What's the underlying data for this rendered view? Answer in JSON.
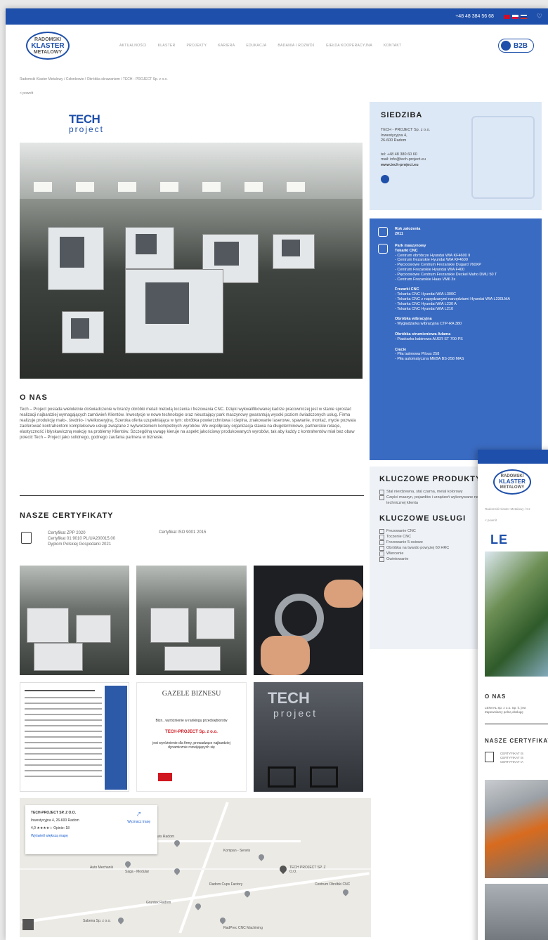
{
  "topbar": {
    "phone": "+48 48 384 56 68",
    "flags": [
      {
        "name": "uk-flag",
        "color": "#c8102e"
      },
      {
        "name": "pl-flag",
        "color": "#dc143c"
      },
      {
        "name": "ru-flag",
        "color": "#0039a6"
      }
    ]
  },
  "logo": {
    "line1": "RADOMSKI",
    "line2": "KLASTER",
    "line3": "METALOWY"
  },
  "nav": [
    "AKTUALNOŚCI",
    "KLASTER",
    "PROJEKTY",
    "KARIERA",
    "EDUKACJA",
    "BADANIA I ROZWÓJ",
    "GIEŁDA KOOPERACYJNA",
    "KONTAKT"
  ],
  "b2b": "B2B",
  "breadcrumb": "Radomski Klaster Metalowy / Członkowie / Obróbka skrawaniem / TECH - PROJECT Sp. z o.o.",
  "back": "< powrót",
  "company_logo": {
    "line1": "TECH",
    "line2": "project"
  },
  "onas": {
    "title": "O NAS",
    "text": "Tech – Project posiada wieloletnie doświadczenie w branży obróbki metali metodą toczenia i frezowania CNC. Dzięki wykwalifikowanej kadrze pracowniczej jest w stanie sprostać realizacji najbardziej wymagających zamówień Klientów. Inwestycje w nowe technologie oraz nieustający park maszynowy gwarantują wysoki poziom świadczonych usług. Firma realizuje produkcję mało-, średnio- i wielkoseryjną. Szeroka oferta uzupełniająca w tym: obróbka powierzchniowa i cieplna, znakowanie laserowe, spawanie, montaż, mycie pozwala zaoferować kontrahentom kompleksowe usługi związane z wytworzeniem kompletnych wyrobów. We współpracy organizacja stawia na długoterminowe, partnerskie relacje, elastyczność i błyskawiczną reakcję na problemy Klientów. Szczególną uwagę kieruje na aspekt jakościowy produkowanych wyrobów, tak aby każdy z kontrahentów miał bez obaw polecić Tech – Project jako solidnego, godnego zaufania partnera w biznesie."
  },
  "certs": {
    "title": "NASZE CERTYFIKATY",
    "col1": [
      "Certyfikat ZPP 2020",
      "Certyfikat 01 9010 PL/UA200015.00",
      "Dyplom Polskiej Gospodarki 2021"
    ],
    "col2": [
      "Certyfikat ISO 9001 2015"
    ]
  },
  "gallery": {
    "gazele_title": "GAZELE BIZNESU",
    "gazele_line1": "Bizn., wyróżnienie w rankingu przedsiębiorstw",
    "gazele_company": "TECH-PROJECT Sp. z o.o.",
    "gazele_line2": "jest wyróżnienie dla firmy, prowadzące najbardziej dynamicznie rozwijających się",
    "wall_line1": "TECH",
    "wall_line2": "project"
  },
  "map": {
    "card_title": "TECH-PROJECT SP. Z O.O.",
    "card_addr": "Inwestycyjna 4, 26-600 Radom",
    "card_rating": "4,0 ★★★★☆ Opinie: 18",
    "card_link": "Wyświetl większą mapę",
    "directions": "Wyznacz trasę",
    "labels": [
      "TECH PROJECT SP. Z O.O.",
      "RadPrec CNC Machining",
      "Radom Cups Factory",
      "Kompan - Serwis",
      "Saga - Modular",
      "Gruntex Radom",
      "MAN Serwis Radom",
      "Auto Mechanik",
      "Centrum Obróbki CNC",
      "Sabena Sp. z o.o."
    ]
  },
  "siedziba": {
    "title": "SIEDZIBA",
    "address": [
      "TECH - PROJECT Sp. z o.o.",
      "Inwestycyjna 4,",
      "26-600 Radom"
    ],
    "contact": [
      "tel: +48 48 380 60 60",
      "mail: info@tech-project.eu",
      "www.tech-project.eu"
    ]
  },
  "info": {
    "rok_label": "Rok założenia",
    "rok_value": "2011",
    "park_label": "Park maszynowy",
    "groups": [
      {
        "title": "Tokarki CNC",
        "items": [
          "- Centrum obróbcze Hyundai WIA KF4600 II",
          "- Centrum frezarskie Hyundai WIA KF4600",
          "- Pięcioosiowe Centrum Frezarskie Dugard 760XP",
          "- Centrum Frezarskie Hyundai WIA F400",
          "- Pięcioosiowe Centrum Frezarskie Deckel Maho DMU 50 T",
          "- Centrum Frezarskie Haas VM6 3x"
        ]
      },
      {
        "title": "Frezarki CNC",
        "items": [
          "- Tokarka CNC Hyundai WIA L300C",
          "- Tokarka CNC z napędzanymi narzędziami Hyundai WIA L230LMA",
          "- Tokarka CNC Hyundai WIA L230 A",
          "- Tokarka CNC Hyundai WIA L210"
        ]
      },
      {
        "title": "Obróbka wibracyjna",
        "items": [
          "- Wygładzarka wibracyjna CTP-RA 380"
        ]
      },
      {
        "title": "Obróbka strumieniowa Adama",
        "items": [
          "- Piaskarka kabinowa AUER ST 700 PS"
        ]
      },
      {
        "title": "Cięcie",
        "items": [
          "- Piła taśmowa Pilous 258",
          "- Piła automatyczna MEBA BS-258 MAS"
        ]
      }
    ]
  },
  "kluczowe": {
    "produkty_title": "KLUCZOWE PRODUKTY",
    "produkty": [
      "Stal nierdzewna, stal czarna, metal kolorowy",
      "Części maszyn, pojazdów i urządzeń wykonywane na podstawie dokumentacji technicznej klienta"
    ],
    "uslugi_title": "KLUCZOWE USŁUGI",
    "uslugi": [
      "Frezowanie CNC",
      "Toczenie CNC",
      "Frezowanie 5-osiowe",
      "Obróbka na twardo powyżej 60 HRC",
      "Wiercenie",
      "Gwintowanie"
    ]
  },
  "overlay": {
    "logo": {
      "line1": "RADOMSKI",
      "line2": "KLASTER",
      "line3": "METALOWY"
    },
    "breadcrumb": "Radomski Klaster Metalowy / Cz",
    "back": "< powrót",
    "brand": "LE",
    "onas_title": "O NAS",
    "onas_text": [
      "LENAAL Sp. z o.o. Sp. k. jest",
      "Zapewniamy pełną obsługę"
    ],
    "cert_title": "NASZE CERTYFIKATY",
    "cert_lines": [
      "CERTYFIKAT IS",
      "CERTYFIKAT IS",
      "CERTYFIKAT IA"
    ]
  }
}
